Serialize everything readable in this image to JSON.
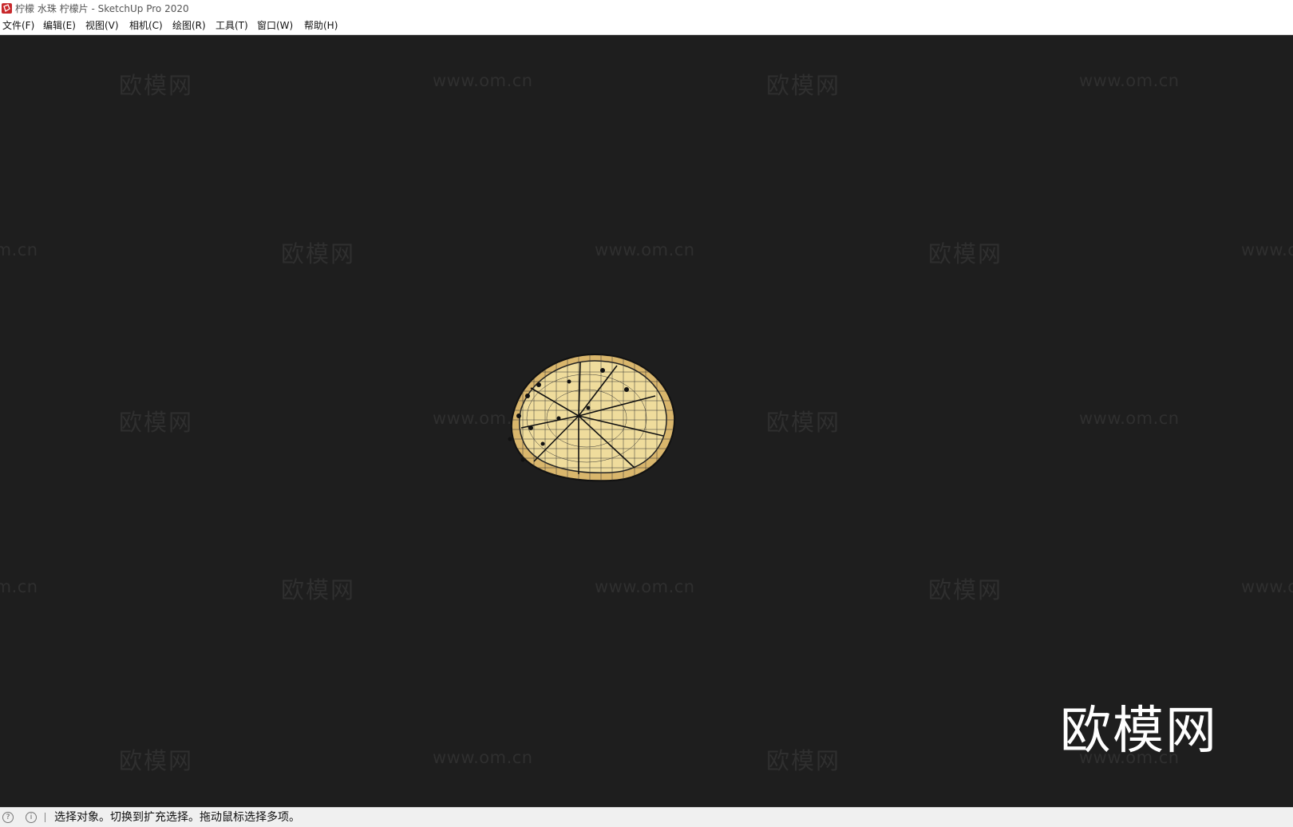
{
  "window": {
    "title": "柠檬 水珠 柠檬片 - SketchUp Pro 2020",
    "app_icon": "sketchup-icon"
  },
  "menu": [
    {
      "id": "file",
      "label": "文件(F)"
    },
    {
      "id": "edit",
      "label": "编辑(E)"
    },
    {
      "id": "view",
      "label": "视图(V)"
    },
    {
      "id": "camera",
      "label": "相机(C)"
    },
    {
      "id": "draw",
      "label": "绘图(R)"
    },
    {
      "id": "tools",
      "label": "工具(T)"
    },
    {
      "id": "window",
      "label": "窗口(W)"
    },
    {
      "id": "help",
      "label": "帮助(H)"
    }
  ],
  "watermarks": {
    "cn": "欧模网",
    "url": "www.om.cn"
  },
  "logo": {
    "text": "欧模网"
  },
  "model": {
    "name": "lemon-slice",
    "fill_color": "#e8d08a",
    "edge_color": "#111111"
  },
  "status": {
    "icons": [
      "geo-location-icon",
      "info-icon"
    ],
    "text": "选择对象。切换到扩充选择。拖动鼠标选择多项。"
  },
  "colors": {
    "viewport_bg": "#1e1e1e",
    "chrome_bg": "#ffffff",
    "statusbar_bg": "#f0f0f0"
  }
}
